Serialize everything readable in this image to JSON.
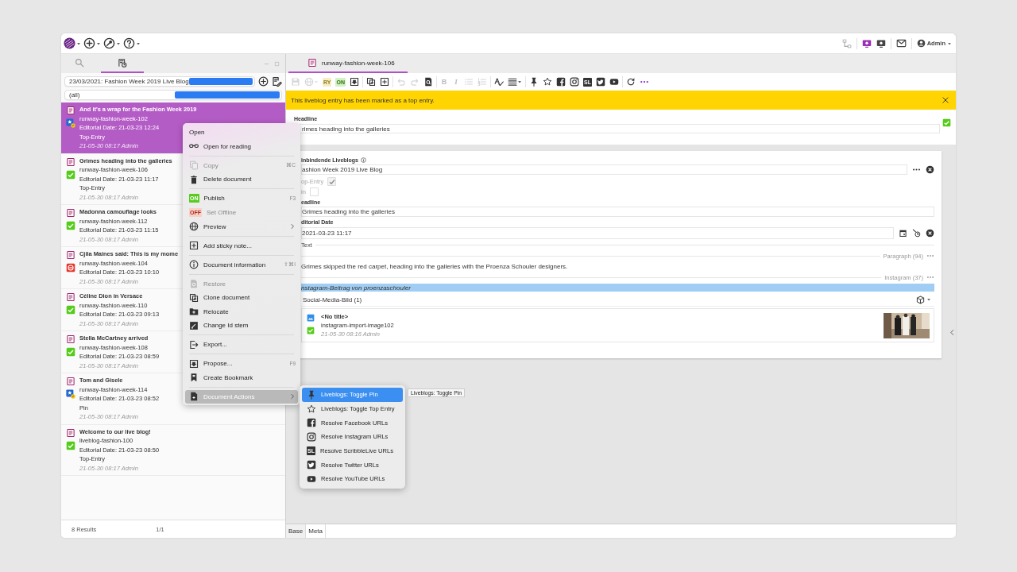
{
  "top_bar": {
    "user": "Admin"
  },
  "left_panel": {
    "tabs": [
      {
        "kind": "search",
        "selected": false
      },
      {
        "kind": "liveblog",
        "selected": true
      }
    ],
    "liveblog_select": "23/03/2021: Fashion Week 2019 Live Blog",
    "filter_select": "(all)",
    "entries": [
      {
        "title": "And it's a wrap for the Fashion Week 2019",
        "id": "runway-fashion-week-102",
        "editorial_date": "Editorial Date: 21-03-23 12:24",
        "tag": "Top-Entry",
        "meta": "21-05-30 08:17 Admin",
        "kind": "top",
        "selected": true
      },
      {
        "title": "Grimes heading into the galleries",
        "id": "runway-fashion-week-106",
        "editorial_date": "Editorial Date: 21-03-23 11:17",
        "tag": "Top-Entry",
        "meta": "21-05-30 08:17 Admin",
        "kind": "check",
        "selected": false
      },
      {
        "title": "Madonna camouflage looks",
        "id": "runway-fashion-week-112",
        "editorial_date": "Editorial Date: 21-03-23 11:15",
        "meta": "21-05-30 08:17 Admin",
        "kind": "check",
        "selected": false
      },
      {
        "title": "Cjila Maines said: This is my mome",
        "id": "runway-fashion-week-104",
        "editorial_date": "Editorial Date: 21-03-23 10:10",
        "meta": "21-05-30 08:17 Admin",
        "kind": "blocked",
        "selected": false
      },
      {
        "title": "Céline Dion in Versace",
        "id": "runway-fashion-week-110",
        "editorial_date": "Editorial Date: 21-03-23 09:13",
        "meta": "21-05-30 08:17 Admin",
        "kind": "check",
        "selected": false
      },
      {
        "title": "Stella McCartney arrived",
        "id": "runway-fashion-week-108",
        "editorial_date": "Editorial Date: 21-03-23 08:59",
        "meta": "21-05-30 08:17 Admin",
        "kind": "check",
        "selected": false
      },
      {
        "title": "Tom and Gisele",
        "id": "runway-fashion-week-114",
        "editorial_date": "Editorial Date: 21-03-23 08:52",
        "tag": "Pin",
        "meta": "21-05-30 08:17 Admin",
        "kind": "top",
        "selected": false
      },
      {
        "title": "Welcome to our live blog!",
        "id": "liveblog-fashion-100",
        "editorial_date": "Editorial Date: 21-03-23 08:50",
        "tag": "Top-Entry",
        "meta": "21-05-30 08:17 Admin",
        "kind": "check",
        "selected": false
      }
    ],
    "footer": {
      "results": "8 Results",
      "pages": "1/1"
    }
  },
  "editor": {
    "tab": "runway-fashion-week-106",
    "toolbar": [
      {
        "items": [
          {
            "kind": "save",
            "disabled": true
          },
          {
            "kind": "globe",
            "disabled": true
          },
          {
            "kind": "ry-badge",
            "text": "RY",
            "disabled": true
          },
          {
            "kind": "on-badge",
            "text": "ON",
            "disabled": true
          },
          {
            "kind": "propose",
            "disabled": false
          }
        ]
      },
      {
        "items": [
          {
            "kind": "clone",
            "disabled": false
          },
          {
            "kind": "note",
            "disabled": false
          }
        ]
      },
      {
        "items": [
          {
            "kind": "undo",
            "disabled": true
          },
          {
            "kind": "redo",
            "disabled": true
          },
          {
            "kind": "preview",
            "disabled": false
          }
        ]
      },
      {
        "items": [
          {
            "kind": "bold",
            "text": "B",
            "disabled": true
          },
          {
            "kind": "italic",
            "text": "I",
            "disabled": true
          },
          {
            "kind": "bullets",
            "disabled": true
          },
          {
            "kind": "numbers",
            "disabled": true
          }
        ]
      },
      {
        "items": [
          {
            "kind": "spellcheck",
            "disabled": false
          },
          {
            "kind": "align",
            "disabled": false
          }
        ]
      },
      {
        "items": [
          {
            "kind": "pin",
            "disabled": false
          },
          {
            "kind": "star",
            "disabled": false
          },
          {
            "kind": "facebook",
            "disabled": false
          },
          {
            "kind": "instagram",
            "disabled": false
          },
          {
            "kind": "sl-badge",
            "text": "SL",
            "disabled": false
          },
          {
            "kind": "twitter",
            "disabled": false
          },
          {
            "kind": "youtube",
            "disabled": false
          }
        ]
      },
      {
        "items": [
          {
            "kind": "refresh",
            "disabled": false
          },
          {
            "kind": "more",
            "disabled": false
          }
        ]
      }
    ],
    "banner": "This liveblog entry has been marked as a top entry.",
    "headline": {
      "label": "Headline",
      "value": "rimes heading into the galleries",
      "checked": true
    },
    "embed_card": {
      "label": "inbindende Liveblogs",
      "liveblog": "ashion Week 2019 Live Blog",
      "flags": [
        {
          "label": "op-Entry",
          "checked": true
        },
        {
          "label": "in",
          "checked": false
        }
      ],
      "fields": [
        {
          "kind": "text",
          "label": "eadline",
          "value": "Grimes heading into the galleries"
        },
        {
          "kind": "date",
          "label": "ditorial Date",
          "value": "2021-03-23 11:17"
        }
      ],
      "text_label": "Text",
      "blocks": [
        {
          "kind": "paragraph",
          "marker": "Paragraph (94)",
          "text": "Grimes skipped the red carpet, heading into the galleries with the Proenza Schouler designers."
        },
        {
          "kind": "instagram",
          "marker": "Instagram (37)",
          "caption": "nstagram-Beitrag von proenzaschouler",
          "gallery_title": "Social-Media-Bild (1)",
          "items": [
            {
              "title": "<No title>",
              "id": "instagram-import-image102",
              "meta": "21-05-30 08:16 Admin",
              "published": true,
              "kind": "picture"
            }
          ]
        }
      ]
    },
    "bottom_tabs": [
      {
        "label": "Base",
        "selected": true
      },
      {
        "label": "Meta",
        "selected": false
      }
    ]
  },
  "context_menu": {
    "sections": [
      {
        "items": [
          {
            "label": "Open",
            "kind": "plain",
            "disabled": false,
            "selected": false
          },
          {
            "label": "Open for reading",
            "kind": "glasses",
            "disabled": false,
            "selected": false
          }
        ]
      },
      {
        "items": [
          {
            "label": "Copy",
            "kind": "copy",
            "shortcut": "⌘C",
            "disabled": true,
            "selected": false
          },
          {
            "label": "Delete document",
            "kind": "trash",
            "disabled": false,
            "selected": false
          }
        ]
      },
      {
        "items": [
          {
            "label": "Publish",
            "kind": "on-badge",
            "badge": "ON",
            "shortcut": "F3",
            "disabled": false,
            "selected": false
          },
          {
            "label": "Set Offline",
            "kind": "off-badge",
            "badge": "OFF",
            "disabled": true,
            "selected": false
          },
          {
            "label": "Preview",
            "kind": "globe",
            "submenu": true,
            "disabled": false,
            "selected": false
          }
        ]
      },
      {
        "items": [
          {
            "label": "Add sticky note...",
            "kind": "note",
            "disabled": false,
            "selected": false
          }
        ]
      },
      {
        "items": [
          {
            "label": "Document information",
            "kind": "info",
            "shortcut": "⇧⌘I",
            "disabled": false,
            "selected": false
          }
        ]
      },
      {
        "items": [
          {
            "label": "Restore",
            "kind": "restore",
            "disabled": true,
            "selected": false
          },
          {
            "label": "Clone document",
            "kind": "clone",
            "disabled": false,
            "selected": false
          },
          {
            "label": "Relocate",
            "kind": "folder",
            "disabled": false,
            "selected": false
          },
          {
            "label": "Change Id stem",
            "kind": "edit",
            "disabled": false,
            "selected": false
          }
        ]
      },
      {
        "items": [
          {
            "label": "Export...",
            "kind": "export",
            "disabled": false,
            "selected": false
          }
        ]
      },
      {
        "items": [
          {
            "label": "Propose...",
            "kind": "propose",
            "shortcut": "F9",
            "disabled": false,
            "selected": false
          },
          {
            "label": "Create Bookmark",
            "kind": "bookmark",
            "disabled": false,
            "selected": false
          }
        ]
      },
      {
        "items": [
          {
            "label": "Document Actions",
            "kind": "docfill",
            "submenu": true,
            "disabled": false,
            "selected": true
          }
        ]
      }
    ]
  },
  "submenu": {
    "items": [
      {
        "label": "Liveblogs: Toggle Pin",
        "kind": "pin",
        "selected": true
      },
      {
        "label": "Liveblogs: Toggle Top Entry",
        "kind": "star",
        "selected": false
      },
      {
        "label": "Resolve Facebook URLs",
        "kind": "facebook",
        "selected": false
      },
      {
        "label": "Resolve Instagram URLs",
        "kind": "instagram",
        "selected": false
      },
      {
        "label": "Resolve ScribbleLive URLs",
        "kind": "sl-badge",
        "badge": "SL",
        "selected": false
      },
      {
        "label": "Resolve Twitter URLs",
        "kind": "twitter",
        "selected": false
      },
      {
        "label": "Resolve YouTube URLs",
        "kind": "youtube",
        "selected": false
      }
    ]
  },
  "tooltip": "Liveblogs: Toggle Pin"
}
